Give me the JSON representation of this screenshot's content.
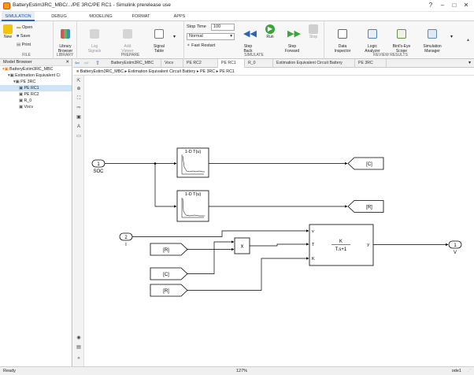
{
  "window": {
    "title": "BatteryEstim3RC_MBC/.../PE 3RC/PE RC1 - Simulink prerelease use"
  },
  "ribbon_tabs": [
    "SIMULATION",
    "DEBUG",
    "MODELING",
    "FORMAT",
    "APPS"
  ],
  "ribbon": {
    "file": {
      "label": "FILE",
      "new": "New",
      "open": "Open",
      "save": "Save",
      "print": "Print"
    },
    "library": {
      "label": "LIBRARY",
      "browser": "Library\nBrowser"
    },
    "prepare": {
      "label": "PREPARE",
      "log_signals": "Log\nSignals",
      "add_viewer": "Add\nViewer",
      "signal_table": "Signal\nTable"
    },
    "simulate": {
      "label": "SIMULATE",
      "stop_time_label": "Stop Time",
      "stop_time_value": "100",
      "mode_value": "Normal",
      "fast_restart": "Fast Restart",
      "step_back": "Step\nBack",
      "run": "Run",
      "step_forward": "Step\nForward",
      "stop": "Stop"
    },
    "review": {
      "label": "REVIEW RESULTS",
      "data_inspector": "Data\nInspector",
      "logic_analyzer": "Logic\nAnalyzer",
      "birds_eye": "Bird's-Eye\nScope",
      "sim_manager": "Simulation\nManager"
    }
  },
  "model_browser": {
    "title": "Model Browser",
    "tree": [
      {
        "label": "BatteryEstim3RC_MBC",
        "level": 0,
        "selected": false
      },
      {
        "label": "Estimation Equivalent Ci",
        "level": 1,
        "selected": false
      },
      {
        "label": "PE 3RC",
        "level": 2,
        "selected": false
      },
      {
        "label": "PE RC1",
        "level": 3,
        "selected": true
      },
      {
        "label": "PE RC2",
        "level": 3,
        "selected": false
      },
      {
        "label": "R_0",
        "level": 3,
        "selected": false
      },
      {
        "label": "Vocv",
        "level": 3,
        "selected": false
      }
    ]
  },
  "doc_tabs": [
    "BatteryEstim3RC_MBC",
    "Vocv",
    "PE RC2",
    "PE RC1",
    "R_0",
    "Estimation Equivalent Circuit Battery",
    "PE 3RC"
  ],
  "breadcrumb": [
    "BatteryEstim3RC_MBC",
    "Estimation Equivalent Circuit Battery",
    "PE 3RC",
    "PE RC1"
  ],
  "diagram": {
    "in1": {
      "num": "1",
      "label": "SOC"
    },
    "in2": {
      "num": "2",
      "label": "I"
    },
    "lookup1": "1-D T(u)",
    "lookup2": "1-D T(u)",
    "goto_c": "[C]",
    "goto_r": "[R]",
    "from_r1": "[R]",
    "from_c": "[C]",
    "from_r2": "[R]",
    "product": "x",
    "tf_num": "K",
    "tf_den": "T.s+1",
    "port_v": "v",
    "port_t": "T",
    "port_k": "K",
    "port_y": "y",
    "out1": {
      "num": "1",
      "label": "V"
    }
  },
  "status": {
    "left": "Ready",
    "zoom": "127%",
    "solver": "ode1"
  }
}
